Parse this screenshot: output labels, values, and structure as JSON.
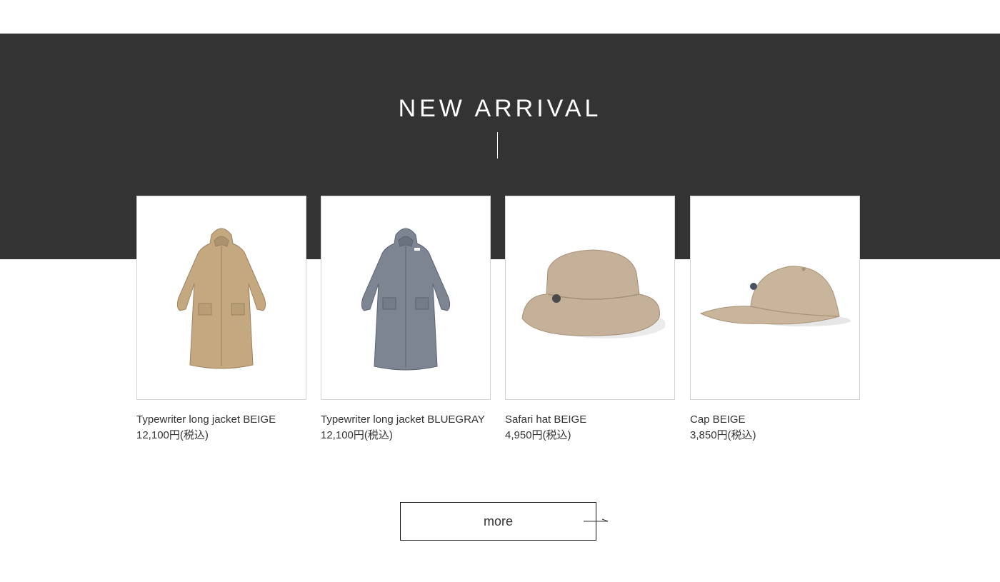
{
  "section": {
    "title": "NEW ARRIVAL"
  },
  "products": [
    {
      "name": "Typewriter long jacket BEIGE",
      "price": "12,100円(税込)",
      "image_icon": "long-jacket-beige",
      "color": "#c4a880"
    },
    {
      "name": "Typewriter long jacket BLUEGRAY",
      "price": "12,100円(税込)",
      "image_icon": "long-jacket-bluegray",
      "color": "#7d8592"
    },
    {
      "name": "Safari hat BEIGE",
      "price": "4,950円(税込)",
      "image_icon": "safari-hat-beige",
      "color": "#c5b09a"
    },
    {
      "name": "Cap BEIGE",
      "price": "3,850円(税込)",
      "image_icon": "cap-beige",
      "color": "#c9b59c"
    }
  ],
  "more_button": {
    "label": "more",
    "icon": "arrow-right-icon"
  },
  "colors": {
    "band": "#333333",
    "text": "#333333",
    "title": "#ffffff"
  }
}
